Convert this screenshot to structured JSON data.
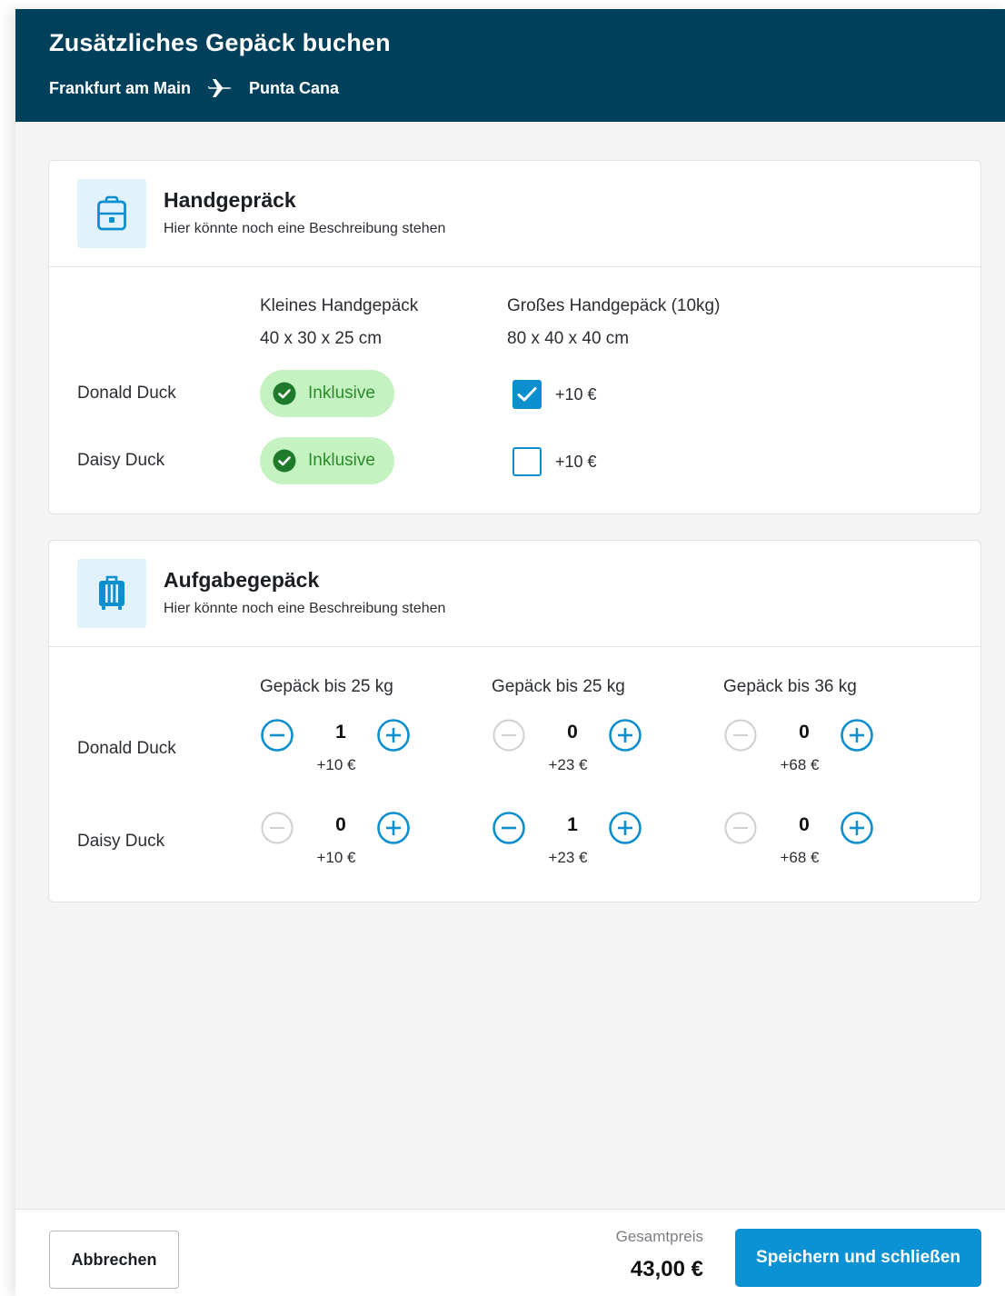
{
  "header": {
    "title": "Zusätzliches Gepäck buchen",
    "from": "Frankfurt am Main",
    "to": "Punta Cana",
    "route_icon": "airplane-icon"
  },
  "hand_luggage": {
    "icon": "backpack-icon",
    "title": "Handgepräck",
    "description": "Hier könnte noch eine Beschreibung stehen",
    "columns": [
      {
        "name": "Kleines Handgepäck",
        "size": "40 x 30 x 25 cm"
      },
      {
        "name": "Großes Handgepäck (10kg)",
        "size": "80 x 40 x 40 cm"
      }
    ],
    "rows": [
      {
        "passenger": "Donald Duck",
        "small_status": "Inklusive",
        "large_checked": true,
        "large_price": "+10 €"
      },
      {
        "passenger": "Daisy Duck",
        "small_status": "Inklusive",
        "large_checked": false,
        "large_price": "+10 €"
      }
    ]
  },
  "checked_luggage": {
    "icon": "suitcase-icon",
    "title": "Aufgabegepäck",
    "description": "Hier könnte noch eine Beschreibung stehen",
    "columns": [
      "Gepäck bis 25 kg",
      "Gepäck bis 25 kg",
      "Gepäck bis 36 kg"
    ],
    "rows": [
      {
        "passenger": "Donald Duck",
        "items": [
          {
            "count": "1",
            "price": "+10 €",
            "minus_enabled": true
          },
          {
            "count": "0",
            "price": "+23 €",
            "minus_enabled": false
          },
          {
            "count": "0",
            "price": "+68 €",
            "minus_enabled": false
          }
        ]
      },
      {
        "passenger": "Daisy Duck",
        "items": [
          {
            "count": "0",
            "price": "+10 €",
            "minus_enabled": false
          },
          {
            "count": "1",
            "price": "+23 €",
            "minus_enabled": true
          },
          {
            "count": "0",
            "price": "+68 €",
            "minus_enabled": false
          }
        ]
      }
    ]
  },
  "footer": {
    "cancel_label": "Abbrechen",
    "total_label": "Gesamtpreis",
    "total_value": "43,00 €",
    "save_label": "Speichern und schließen"
  },
  "colors": {
    "header_bg": "#00405a",
    "accent": "#0b92d4",
    "included_bg": "#c5f2c1",
    "included_fg": "#2c8a2c",
    "disabled": "#c8c8c8"
  }
}
